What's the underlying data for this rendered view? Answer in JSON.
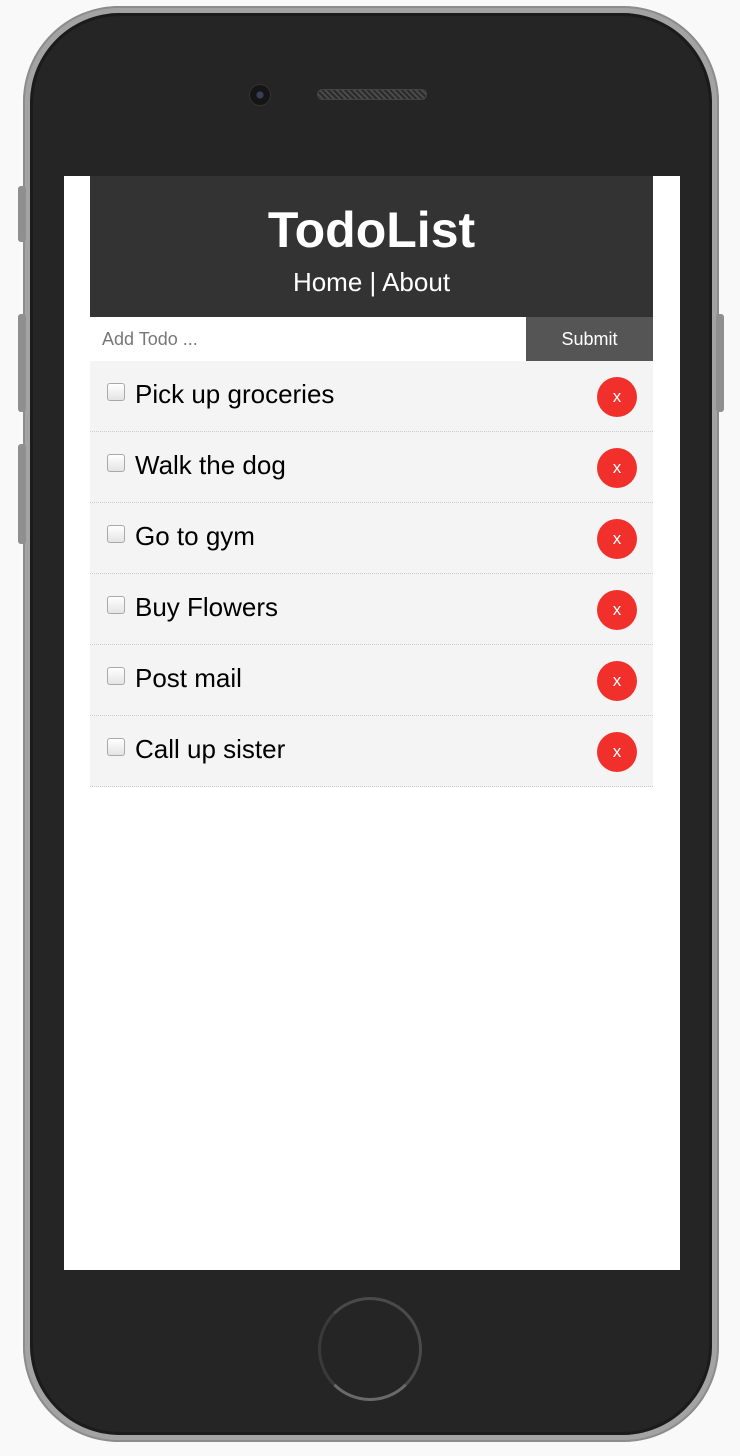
{
  "app": {
    "title": "TodoList"
  },
  "nav": {
    "home": "Home",
    "separator": "|",
    "about": "About"
  },
  "form": {
    "placeholder": "Add Todo ...",
    "value": "",
    "submit_label": "Submit"
  },
  "todos": [
    {
      "text": "Pick up groceries",
      "completed": false,
      "delete_label": "x"
    },
    {
      "text": "Walk the dog",
      "completed": false,
      "delete_label": "x"
    },
    {
      "text": "Go to gym",
      "completed": false,
      "delete_label": "x"
    },
    {
      "text": "Buy Flowers",
      "completed": false,
      "delete_label": "x"
    },
    {
      "text": "Post mail",
      "completed": false,
      "delete_label": "x"
    },
    {
      "text": "Call up sister",
      "completed": false,
      "delete_label": "x"
    }
  ],
  "colors": {
    "header_bg": "#333333",
    "submit_bg": "#555555",
    "delete_bg": "#f1302b",
    "item_bg": "#f4f4f4"
  }
}
